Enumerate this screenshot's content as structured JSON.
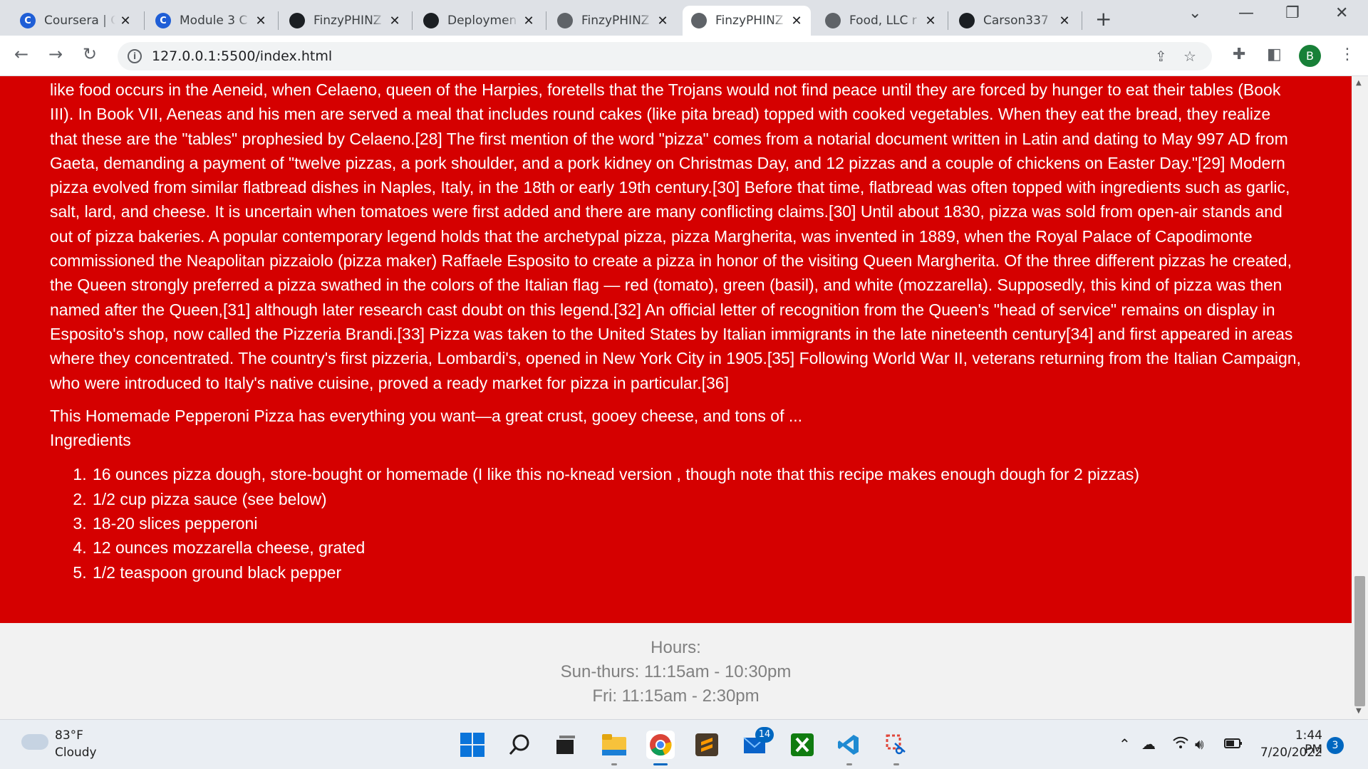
{
  "browser": {
    "tabs": [
      {
        "title": "Coursera | C",
        "icon": "coursera-icon"
      },
      {
        "title": "Module 3 C",
        "icon": "coursera-icon"
      },
      {
        "title": "FinzyPHINZ",
        "icon": "github-icon"
      },
      {
        "title": "Deploymen",
        "icon": "github-icon"
      },
      {
        "title": "FinzyPHINZ",
        "icon": "globe-icon"
      },
      {
        "title": "FinzyPHINZ",
        "icon": "globe-icon",
        "active": true
      },
      {
        "title": "Food, LLC r",
        "icon": "globe-icon"
      },
      {
        "title": "Carson337",
        "icon": "github-icon"
      }
    ],
    "new_tab": "+",
    "url": "127.0.0.1:5500/index.html",
    "profile_initial": "B"
  },
  "page": {
    "background_color": "#d50000",
    "history_text": "like food occurs in the Aeneid, when Celaeno, queen of the Harpies, foretells that the Trojans would not find peace until they are forced by hunger to eat their tables (Book III). In Book VII, Aeneas and his men are served a meal that includes round cakes (like pita bread) topped with cooked vegetables. When they eat the bread, they realize that these are the \"tables\" prophesied by Celaeno.[28] The first mention of the word \"pizza\" comes from a notarial document written in Latin and dating to May 997 AD from Gaeta, demanding a payment of \"twelve pizzas, a pork shoulder, and a pork kidney on Christmas Day, and 12 pizzas and a couple of chickens on Easter Day.\"[29] Modern pizza evolved from similar flatbread dishes in Naples, Italy, in the 18th or early 19th century.[30] Before that time, flatbread was often topped with ingredients such as garlic, salt, lard, and cheese. It is uncertain when tomatoes were first added and there are many conflicting claims.[30] Until about 1830, pizza was sold from open-air stands and out of pizza bakeries. A popular contemporary legend holds that the archetypal pizza, pizza Margherita, was invented in 1889, when the Royal Palace of Capodimonte commissioned the Neapolitan pizzaiolo (pizza maker) Raffaele Esposito to create a pizza in honor of the visiting Queen Margherita. Of the three different pizzas he created, the Queen strongly preferred a pizza swathed in the colors of the Italian flag — red (tomato), green (basil), and white (mozzarella). Supposedly, this kind of pizza was then named after the Queen,[31] although later research cast doubt on this legend.[32] An official letter of recognition from the Queen's \"head of service\" remains on display in Esposito's shop, now called the Pizzeria Brandi.[33] Pizza was taken to the United States by Italian immigrants in the late nineteenth century[34] and first appeared in areas where they concentrated. The country's first pizzeria, Lombardi's, opened in New York City in 1905.[35] Following World War II, veterans returning from the Italian Campaign, who were introduced to Italy's native cuisine, proved a ready market for pizza in particular.[36]",
    "recipe_intro": "This Homemade Pepperoni Pizza has everything you want—a great crust, gooey cheese, and tons of ...",
    "ingredients_heading": "Ingredients",
    "ingredients": [
      "16 ounces pizza dough, store-bought or homemade (I like this no-knead version , though note that this recipe makes enough dough for 2 pizzas)",
      "1/2 cup pizza sauce (see below)",
      "18-20 slices pepperoni",
      "12 ounces mozzarella cheese, grated",
      "1/2 teaspoon ground black pepper"
    ]
  },
  "footer": {
    "hours_label": "Hours:",
    "hours": [
      "Sun-thurs: 11:15am - 10:30pm",
      "Fri: 11:15am - 2:30pm"
    ]
  },
  "taskbar": {
    "weather_temp": "83°F",
    "weather_desc": "Cloudy",
    "mail_badge": "14",
    "time": "1:44 PM",
    "date": "7/20/2022",
    "notifications": "3"
  }
}
